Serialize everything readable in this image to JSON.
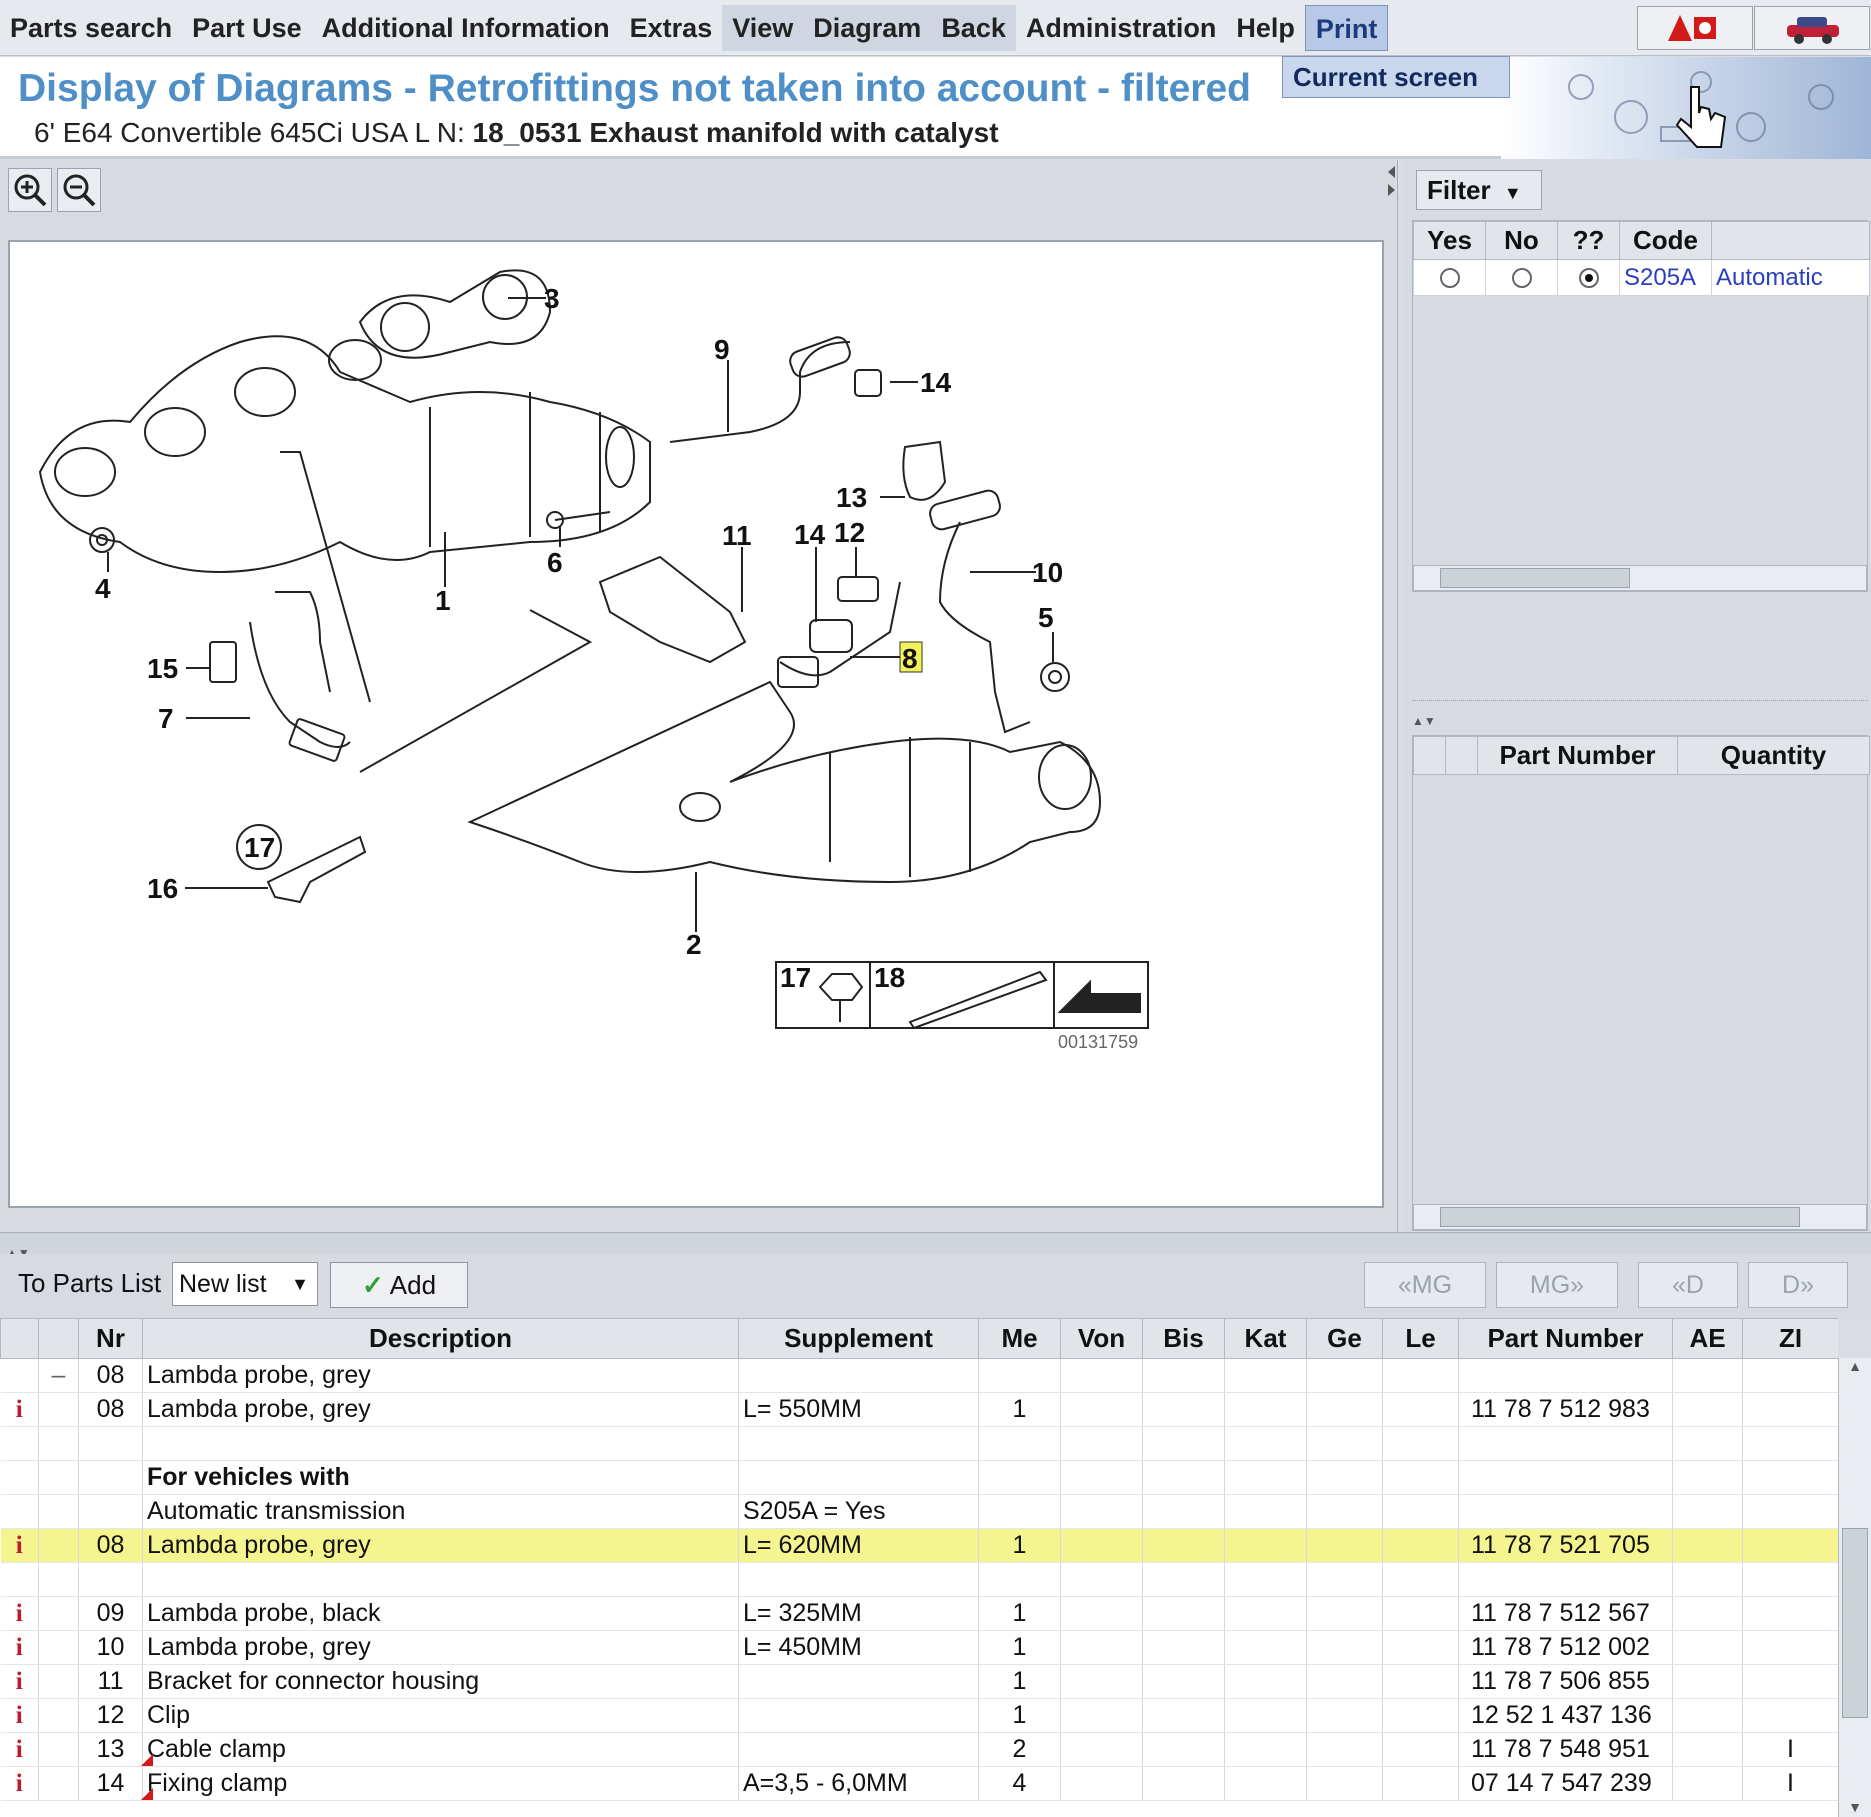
{
  "menu": {
    "items": [
      "Parts search",
      "Part Use",
      "Additional Information",
      "Extras",
      "View",
      "Diagram",
      "Back",
      "Administration",
      "Help",
      "Print"
    ],
    "dropdown_item": "Current screen"
  },
  "header": {
    "title": "Display of Diagrams - Retrofittings not taken into account - filtered",
    "subtitle_model": "6' E64 Convertible 645Ci USA  L N: ",
    "subtitle_group": "18_0531 Exhaust manifold with catalyst"
  },
  "diagram": {
    "callouts": [
      "1",
      "2",
      "3",
      "4",
      "5",
      "6",
      "7",
      "8",
      "9",
      "10",
      "11",
      "12",
      "13",
      "14",
      "14",
      "15",
      "16",
      "17",
      "17",
      "18"
    ],
    "image_number": "00131759"
  },
  "filter": {
    "button_label": "Filter",
    "columns": [
      "Yes",
      "No",
      "??",
      "Code",
      ""
    ],
    "rows": [
      {
        "selected": "??",
        "code": "S205A",
        "description": "Automatic"
      }
    ]
  },
  "parts_mini": {
    "columns": [
      "",
      "",
      "Part Number",
      "Quantity"
    ]
  },
  "toolbar": {
    "to_parts_label": "To Parts List",
    "list_value": "New list",
    "add_label": "Add",
    "nav": [
      "«MG",
      "MG»",
      "«D",
      "D»"
    ]
  },
  "parts_table": {
    "columns": [
      "",
      "",
      "Nr",
      "Description",
      "Supplement",
      "Me",
      "Von",
      "Bis",
      "Kat",
      "Ge",
      "Le",
      "Part Number",
      "AE",
      "ZI"
    ],
    "rows": [
      {
        "info": "",
        "tree": "–",
        "nr": "08",
        "desc": "Lambda probe, grey",
        "supp": "",
        "me": "",
        "pn": "",
        "zi": "",
        "bold": false,
        "hl": false
      },
      {
        "info": "i",
        "tree": "",
        "nr": "08",
        "desc": "Lambda probe, grey",
        "supp": "L= 550MM",
        "me": "1",
        "pn": "11 78 7 512 983",
        "zi": "",
        "bold": false,
        "hl": false
      },
      {
        "info": "",
        "tree": "",
        "nr": "",
        "desc": "",
        "supp": "",
        "me": "",
        "pn": "",
        "zi": "",
        "bold": false,
        "hl": false
      },
      {
        "info": "",
        "tree": "",
        "nr": "",
        "desc": "For vehicles with",
        "supp": "",
        "me": "",
        "pn": "",
        "zi": "",
        "bold": true,
        "hl": false
      },
      {
        "info": "",
        "tree": "",
        "nr": "",
        "desc": "Automatic transmission",
        "supp": "S205A = Yes",
        "me": "",
        "pn": "",
        "zi": "",
        "bold": false,
        "hl": false
      },
      {
        "info": "i",
        "tree": "",
        "nr": "08",
        "desc": "Lambda probe, grey",
        "supp": "L= 620MM",
        "me": "1",
        "pn": "11 78 7 521 705",
        "zi": "",
        "bold": false,
        "hl": true
      },
      {
        "info": "",
        "tree": "",
        "nr": "",
        "desc": "",
        "supp": "",
        "me": "",
        "pn": "",
        "zi": "",
        "bold": false,
        "hl": false
      },
      {
        "info": "i",
        "tree": "",
        "nr": "09",
        "desc": "Lambda probe, black",
        "supp": "L= 325MM",
        "me": "1",
        "pn": "11 78 7 512 567",
        "zi": "",
        "bold": false,
        "hl": false
      },
      {
        "info": "i",
        "tree": "",
        "nr": "10",
        "desc": "Lambda probe, grey",
        "supp": "L= 450MM",
        "me": "1",
        "pn": "11 78 7 512 002",
        "zi": "",
        "bold": false,
        "hl": false
      },
      {
        "info": "i",
        "tree": "",
        "nr": "11",
        "desc": "Bracket for connector housing",
        "supp": "",
        "me": "1",
        "pn": "11 78 7 506 855",
        "zi": "",
        "bold": false,
        "hl": false
      },
      {
        "info": "i",
        "tree": "",
        "nr": "12",
        "desc": "Clip",
        "supp": "",
        "me": "1",
        "pn": "12 52 1 437 136",
        "zi": "",
        "bold": false,
        "hl": false
      },
      {
        "info": "i",
        "tree": "",
        "nr": "13",
        "desc": "Cable clamp",
        "supp": "",
        "me": "2",
        "pn": "11 78 7 548 951",
        "zi": "I",
        "bold": false,
        "hl": false,
        "flag": true
      },
      {
        "info": "i",
        "tree": "",
        "nr": "14",
        "desc": "Fixing clamp",
        "supp": "A=3,5 - 6,0MM",
        "me": "4",
        "pn": "07 14 7 547 239",
        "zi": "I",
        "bold": false,
        "hl": false,
        "flag": true
      }
    ]
  }
}
